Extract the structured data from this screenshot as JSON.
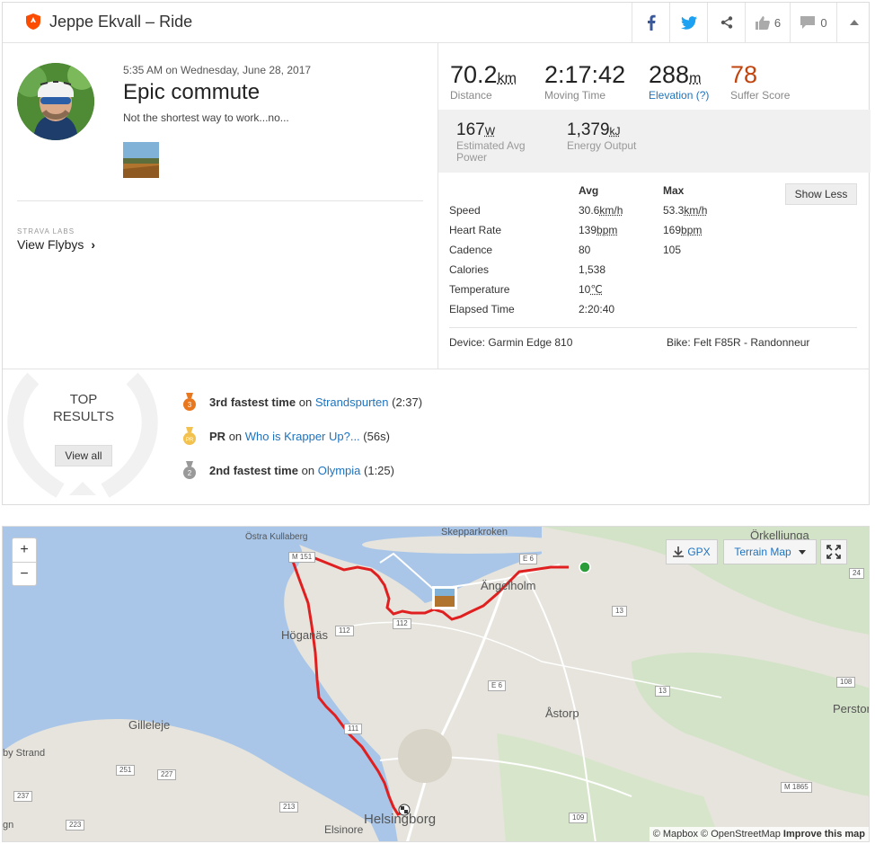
{
  "header": {
    "title": "Jeppe Ekvall – Ride",
    "kudos_count": "6",
    "comment_count": "0"
  },
  "activity": {
    "date": "5:35 AM on Wednesday, June 28, 2017",
    "name": "Epic commute",
    "description": "Not the shortest way to work...no...",
    "labs_label": "STRAVA LABS",
    "flyby_label": "View Flybys"
  },
  "stats": [
    {
      "value": "70.2",
      "unit": "km",
      "label": "Distance"
    },
    {
      "value": "2:17:42",
      "unit": "",
      "label": "Moving Time"
    },
    {
      "value": "288",
      "unit": "m",
      "label": "Elevation (?)"
    },
    {
      "value": "78",
      "unit": "",
      "label": "Suffer Score"
    }
  ],
  "power": [
    {
      "value": "167",
      "unit": "W",
      "label": "Estimated Avg Power"
    },
    {
      "value": "1,379",
      "unit": "kJ",
      "label": "Energy Output"
    }
  ],
  "details": {
    "headers": [
      "",
      "Avg",
      "Max"
    ],
    "rows": [
      {
        "label": "Speed",
        "avg": "30.6",
        "avg_unit": "km/h",
        "max": "53.3",
        "max_unit": "km/h"
      },
      {
        "label": "Heart Rate",
        "avg": "139",
        "avg_unit": "bpm",
        "max": "169",
        "max_unit": "bpm"
      },
      {
        "label": "Cadence",
        "avg": "80",
        "avg_unit": "",
        "max": "105",
        "max_unit": ""
      },
      {
        "label": "Calories",
        "avg": "1,538",
        "avg_unit": "",
        "max": "",
        "max_unit": ""
      },
      {
        "label": "Temperature",
        "avg": "10",
        "avg_unit": "℃",
        "max": "",
        "max_unit": ""
      },
      {
        "label": "Elapsed Time",
        "avg": "2:20:40",
        "avg_unit": "",
        "max": "",
        "max_unit": ""
      }
    ],
    "show_less": "Show Less",
    "device": "Device: Garmin Edge 810",
    "bike": "Bike: Felt F85R - Randonneur"
  },
  "results": {
    "title_line1": "TOP",
    "title_line2": "RESULTS",
    "view_all": "View all",
    "items": [
      {
        "badge": "3",
        "strong": "3rd fastest time",
        "on": "on",
        "segment": "Strandspurten",
        "time": "(2:37)",
        "color": "#e8771e"
      },
      {
        "badge": "PR",
        "strong": "PR",
        "on": "on",
        "segment": "Who is Krapper Up?...",
        "time": "(56s)",
        "color": "#f2c14e"
      },
      {
        "badge": "2",
        "strong": "2nd fastest time",
        "on": "on",
        "segment": "Olympia",
        "time": "(1:25)",
        "color": "#999999"
      }
    ]
  },
  "map": {
    "zoom_in": "+",
    "zoom_out": "−",
    "gpx": "GPX",
    "terrain": "Terrain Map",
    "labels": {
      "ostra_kullaberg": "Östra Kullaberg",
      "skepparkroken": "Skepparkroken",
      "orkelljunga": "Örkelljunga",
      "angelholm": "Ängelholm",
      "hoganas": "Höganäs",
      "astorp": "Åstorp",
      "gilleleje": "Gilleleje",
      "persto": "Perstor",
      "helsingborg": "Helsingborg",
      "elsinore": "Elsinore",
      "strand": "by Strand",
      "gn": "gn"
    },
    "roads": [
      "E 6",
      "13",
      "112",
      "E 6",
      "13",
      "111",
      "108",
      "251",
      "227",
      "237",
      "213",
      "223",
      "109",
      "M 1865",
      "24",
      "M 151",
      "112"
    ],
    "attribution": "© Mapbox © OpenStreetMap",
    "improve": "Improve this map"
  },
  "colors": {
    "brand": "#fc4c02",
    "link": "#1e73be",
    "route": "#e02020",
    "suffer": "#c1440e"
  }
}
